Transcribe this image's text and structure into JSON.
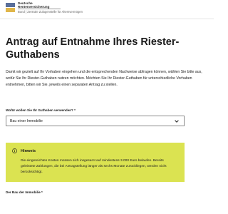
{
  "header": {
    "brand_line1": "Deutsche",
    "brand_line2": "Rentenversicherung",
    "brand_line3": "Bund | Zentrale Zulagenstelle für Altersvermögen"
  },
  "page": {
    "title_line1": "Antrag auf Entnahme Ihres Riester-",
    "title_line2": "Guthabens",
    "intro": "Damit wir gezielt auf Ihr Vorhaben eingehen und die entsprechenden Nachweise abfragen können, wählen Sie bitte aus, wofür Sie Ihr Riester-Guthaben nutzen möchten. Möchten Sie Ihr Riester-Guthaben für unterschiedliche Vorhaben entnehmen, bitten wir Sie, jeweils einen separaten Antrag zu stellen."
  },
  "purpose_field": {
    "label": "Wofür wollen Sie Ihr Guthaben verwenden? *",
    "selected_value": "Bau einer Immobilie"
  },
  "hint": {
    "title": "Hinweis",
    "text": "Die eingereichten Kosten müssen sich insgesamt auf mindestens 3.000 Euro belaufen. Bereits geleistete Zahlungen, die bei Antragstellung länger als sechs Monate zurückliegen, werden nicht berücksichtigt."
  },
  "next_field": {
    "label": "Der Bau der Immobilie *"
  },
  "colors": {
    "hint_background": "#dbe351",
    "logo_blue": "#5a6f9a",
    "logo_yellow": "#e0b64a"
  },
  "icons": {
    "hint": "info-circle-icon",
    "select": "chevron-down-icon"
  }
}
